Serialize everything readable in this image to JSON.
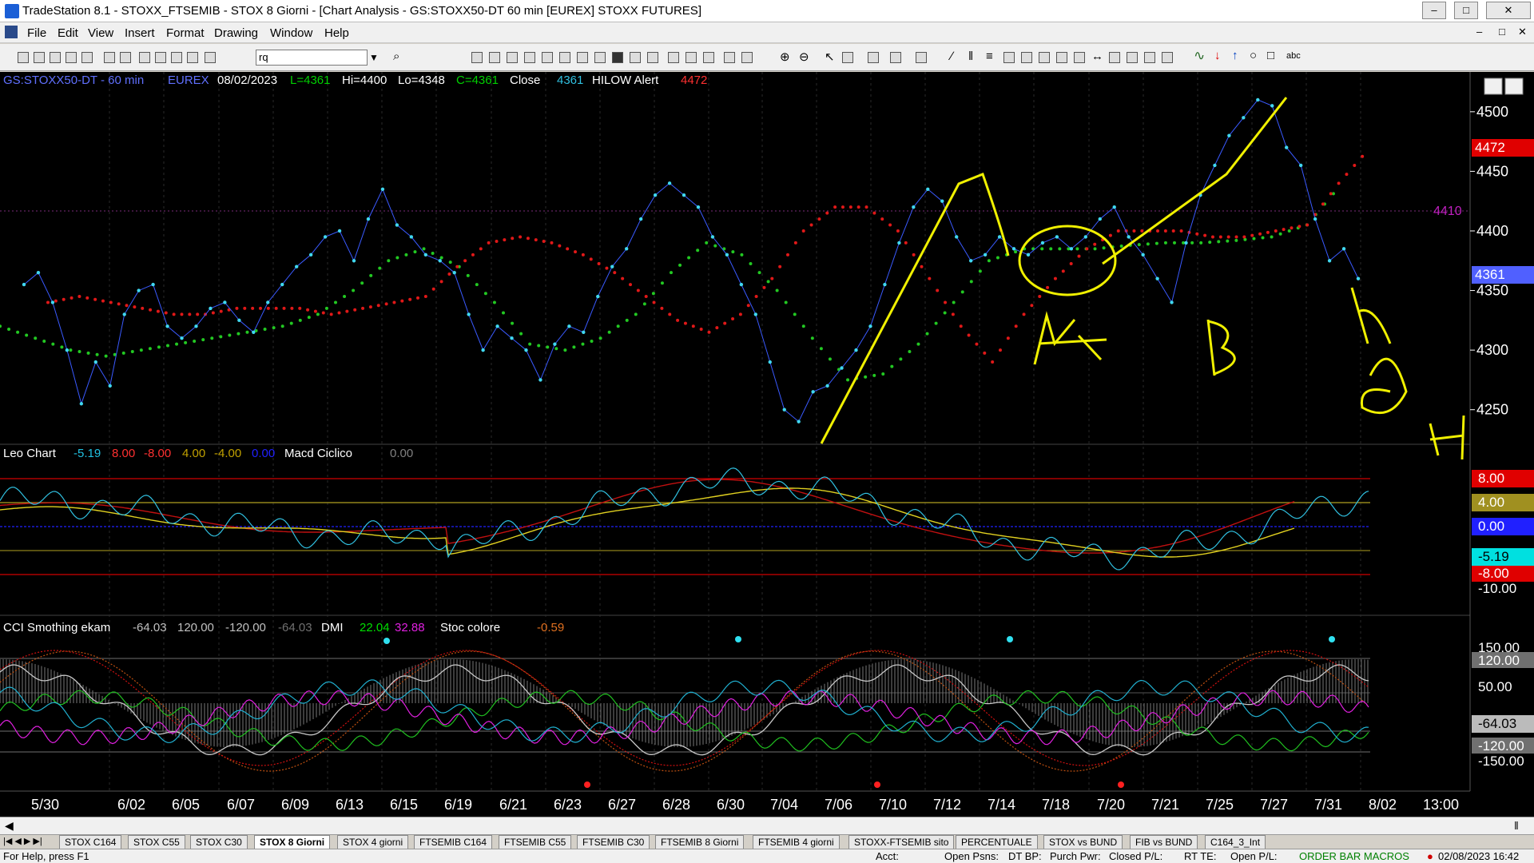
{
  "window": {
    "title": "TradeStation 8.1 - STOXX_FTSEMIB - STOX  8 Giorni - [Chart Analysis - GS:STOXX50-DT  60 min  [EUREX] STOXX FUTURES]",
    "min": "–",
    "max": "□",
    "close": "✕"
  },
  "menu": [
    "File",
    "Edit",
    "View",
    "Insert",
    "Format",
    "Drawing",
    "Window",
    "Help"
  ],
  "toolbar": {
    "combo_value": "rq"
  },
  "price_header": {
    "symbol": "GS:STOXX50-DT - 60 min",
    "exchange": "EUREX",
    "date": "08/02/2023",
    "last": "L=4361",
    "hi": "Hi=4400",
    "lo": "Lo=4348",
    "close_eq": "C=4361",
    "close_label": "Close",
    "close_val": "4361",
    "alert_label": "HILOW Alert",
    "alert_val": "4472"
  },
  "price_axis": {
    "ticks": [
      "4500",
      "4450",
      "4400",
      "4350",
      "4300",
      "4250"
    ],
    "badge_alert": "4472",
    "badge_last": "4361",
    "line_4410": "4410"
  },
  "leo_header": {
    "name": "Leo Chart",
    "v1": "-5.19",
    "v2": "8.00",
    "v3": "-8.00",
    "v4": "4.00",
    "v5": "-4.00",
    "v6": "0.00",
    "macd": "Macd Ciclico",
    "macd_v": "0.00"
  },
  "leo_axis": {
    "b1": "8.00",
    "b2": "4.00",
    "b3": "0.00",
    "b4": "-5.19",
    "b5": "-8.00",
    "tick": "-10.00"
  },
  "cci_header": {
    "name": "CCI Smothing ekam",
    "v1": "-64.03",
    "v2": "120.00",
    "v3": "-120.00",
    "v4": "-64.03",
    "dmi": "DMI",
    "dmi1": "22.04",
    "dmi2": "32.88",
    "stoc": "Stoc colore",
    "stoc_v": "-0.59"
  },
  "cci_axis": {
    "t150": "150.00",
    "b120": "120.00",
    "t50": "50.00",
    "b64": "-64.03",
    "b120n": "-120.00",
    "t150n": "-150.00"
  },
  "x_axis": [
    "5/30",
    "6/02",
    "6/05",
    "6/07",
    "6/09",
    "6/13",
    "6/15",
    "6/19",
    "6/21",
    "6/23",
    "6/27",
    "6/28",
    "6/30",
    "7/04",
    "7/06",
    "7/10",
    "7/12",
    "7/14",
    "7/18",
    "7/20",
    "7/21",
    "7/25",
    "7/27",
    "7/31",
    "8/02",
    "13:00"
  ],
  "annotations": {
    "a": "A",
    "b": "B",
    "f": "F",
    "g": "G",
    "h": "H"
  },
  "tabs": [
    "STOX C164",
    "STOX C55",
    "STOX  C30",
    "STOX  8 Giorni",
    "STOX 4 giorni",
    "FTSEMIB C164",
    "FTSEMIB C55",
    "FTSEMIB C30",
    "FTSEMIB  8 Giorni",
    "FTSEMIB  4 giorni",
    "STOXX-FTSEMIB sito",
    "PERCENTUALE",
    "STOX vs BUND",
    "FIB vs BUND",
    "C164_3_Int"
  ],
  "status": {
    "help": "For Help, press F1",
    "acct": "Acct:",
    "psns": "Open Psns:",
    "dtbp": "DT BP:",
    "purch": "Purch Pwr:",
    "closed": "Closed P/L:",
    "rtte": "RT TE:",
    "openpl": "Open P/L:",
    "order": "ORDER BAR  MACROS",
    "datetime": "02/08/2023 16:42"
  },
  "chart_data": {
    "type": "line",
    "x_labels": [
      "5/30",
      "6/02",
      "6/05",
      "6/07",
      "6/09",
      "6/13",
      "6/15",
      "6/19",
      "6/21",
      "6/23",
      "6/27",
      "6/28",
      "6/30",
      "7/04",
      "7/06",
      "7/10",
      "7/12",
      "7/14",
      "7/18",
      "7/20",
      "7/21",
      "7/25",
      "7/27",
      "7/31",
      "8/02",
      "13:00"
    ],
    "ylim": [
      4225,
      4520
    ],
    "price_series": [
      4355,
      4365,
      4340,
      4300,
      4255,
      4290,
      4270,
      4330,
      4350,
      4355,
      4320,
      4310,
      4320,
      4335,
      4340,
      4325,
      4315,
      4340,
      4355,
      4370,
      4380,
      4395,
      4400,
      4375,
      4410,
      4435,
      4405,
      4395,
      4380,
      4375,
      4365,
      4330,
      4300,
      4320,
      4310,
      4300,
      4275,
      4305,
      4320,
      4315,
      4345,
      4370,
      4385,
      4410,
      4430,
      4440,
      4430,
      4420,
      4395,
      4380,
      4355,
      4330,
      4290,
      4250,
      4240,
      4265,
      4270,
      4285,
      4300,
      4320,
      4355,
      4390,
      4420,
      4435,
      4425,
      4395,
      4375,
      4380,
      4395,
      4385,
      4380,
      4390,
      4395,
      4385,
      4395,
      4410,
      4420,
      4395,
      4380,
      4360,
      4340,
      4390,
      4430,
      4455,
      4480,
      4495,
      4510,
      4505,
      4470,
      4455,
      4410,
      4375,
      4385,
      4360
    ],
    "upper_band": [
      4340,
      4345,
      4340,
      4335,
      4330,
      4330,
      4335,
      4335,
      4335,
      4330,
      4335,
      4340,
      4345,
      4370,
      4390,
      4395,
      4390,
      4380,
      4365,
      4345,
      4325,
      4315,
      4330,
      4360,
      4400,
      4420,
      4420,
      4400,
      4360,
      4320,
      4290,
      4330,
      4360,
      4385,
      4400,
      4400,
      4400,
      4395,
      4395,
      4400,
      4405,
      4440,
      4470
    ],
    "lower_band": [
      4320,
      4310,
      4300,
      4295,
      4300,
      4305,
      4310,
      4315,
      4320,
      4330,
      4350,
      4375,
      4385,
      4370,
      4340,
      4305,
      4300,
      4310,
      4330,
      4365,
      4390,
      4380,
      4350,
      4310,
      4275,
      4280,
      4305,
      4340,
      4375,
      4385,
      4385,
      4385,
      4388,
      4390,
      4390,
      4392,
      4395,
      4405,
      4440
    ],
    "leo_ylim": [
      -10,
      10
    ],
    "leo_levels": [
      8,
      4,
      0,
      -5.19,
      -8
    ],
    "cci_ylim": [
      -150,
      150
    ],
    "cci_levels": [
      120,
      50,
      -64.03,
      -120
    ]
  }
}
